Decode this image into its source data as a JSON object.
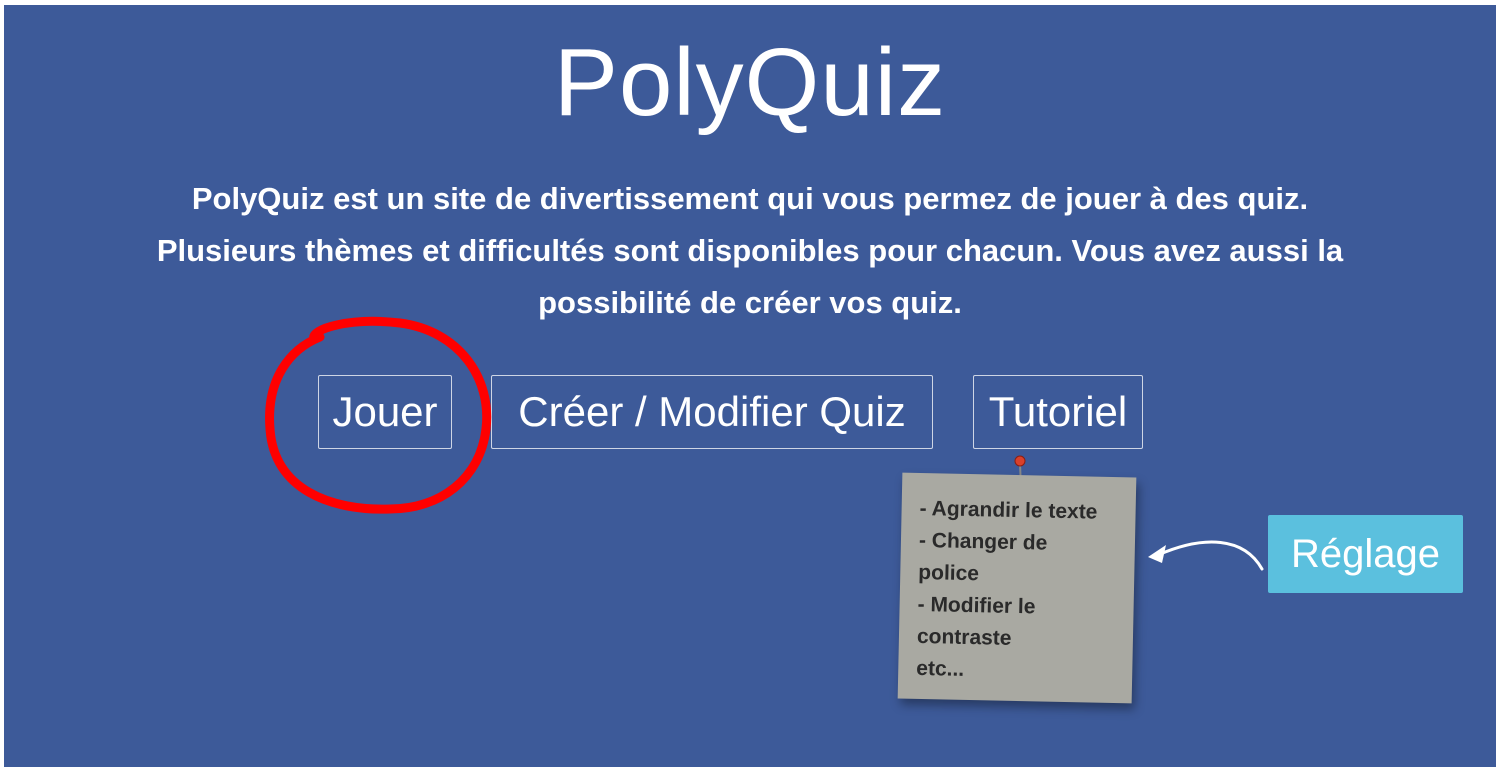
{
  "header": {
    "title": "PolyQuiz"
  },
  "intro": {
    "line1": "PolyQuiz est un site de divertissement qui vous permez de jouer à des quiz.",
    "line2": "Plusieurs thèmes et difficultés sont disponibles pour chacun. Vous avez aussi la",
    "line3": "possibilité de créer vos quiz."
  },
  "menu": {
    "play_label": "Jouer",
    "create_label": "Créer / Modifier Quiz",
    "tutorial_label": "Tutoriel"
  },
  "note": {
    "lines": [
      "- Agrandir le texte",
      "- Changer de",
      "police",
      "- Modifier le",
      "contraste",
      "etc..."
    ]
  },
  "settings": {
    "label": "Réglage"
  },
  "colors": {
    "background": "#3d5a99",
    "settings_button": "#5bc0de",
    "highlight": "#ff0000",
    "note_paper": "#a9a9a2"
  }
}
